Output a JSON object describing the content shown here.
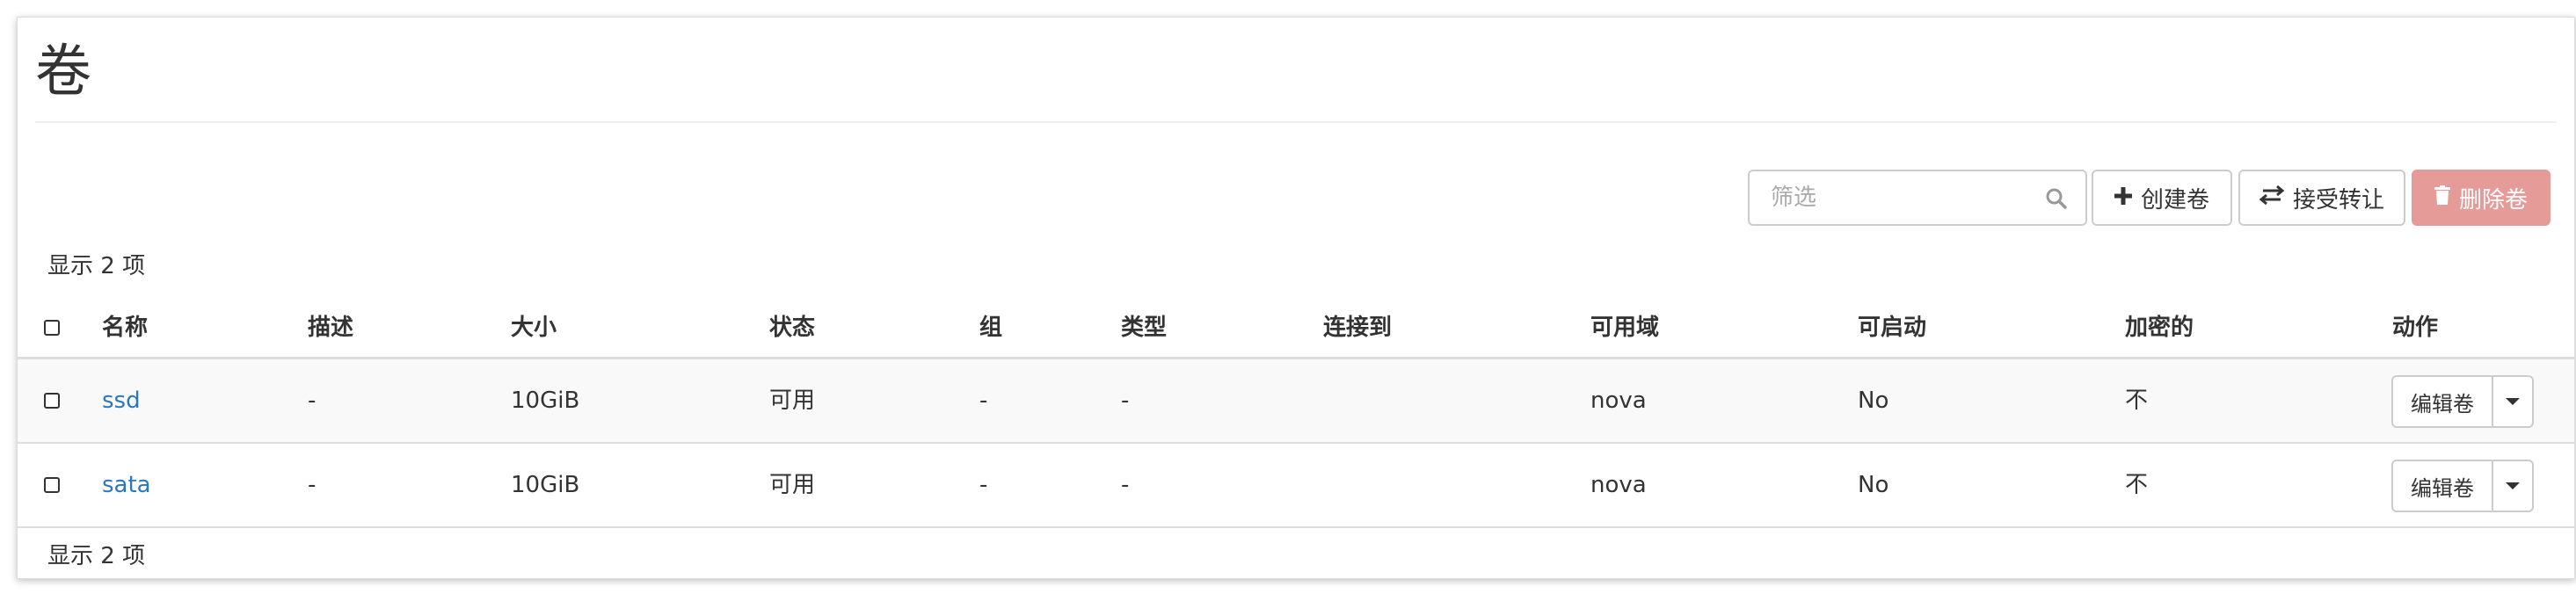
{
  "page": {
    "title": "卷"
  },
  "toolbar": {
    "filter_placeholder": "筛选",
    "create_label": "创建卷",
    "accept_transfer_label": "接受转让",
    "delete_label": "删除卷"
  },
  "summary": {
    "count_text": "显示 2 项"
  },
  "table": {
    "columns": [
      "名称",
      "描述",
      "大小",
      "状态",
      "组",
      "类型",
      "连接到",
      "可用域",
      "可启动",
      "加密的",
      "动作"
    ],
    "rows": [
      {
        "name": "ssd",
        "description": "-",
        "size": "10GiB",
        "status": "可用",
        "group": "-",
        "type": "-",
        "attached_to": "",
        "availability_zone": "nova",
        "bootable": "No",
        "encrypted": "不",
        "action_label": "编辑卷"
      },
      {
        "name": "sata",
        "description": "-",
        "size": "10GiB",
        "status": "可用",
        "group": "-",
        "type": "-",
        "attached_to": "",
        "availability_zone": "nova",
        "bootable": "No",
        "encrypted": "不",
        "action_label": "编辑卷"
      }
    ]
  },
  "icons": {
    "search": "search-icon",
    "create": "plus-icon",
    "accept": "transfer-arrows-icon",
    "delete": "trash-icon",
    "action_menu": "caret-down-icon"
  },
  "colors": {
    "link": "#2a78b9",
    "delete_button": "#e59b98",
    "row_alt": "#f9f9f9"
  }
}
